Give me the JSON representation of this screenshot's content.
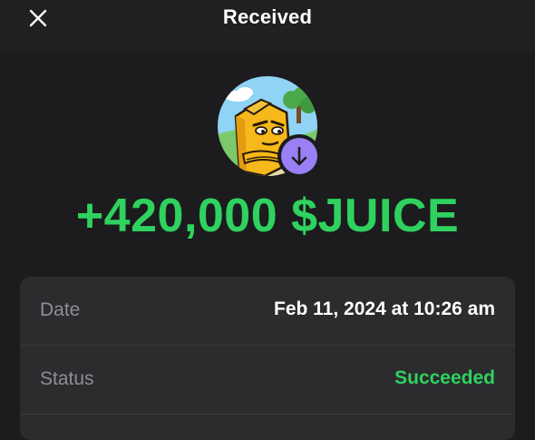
{
  "header": {
    "title": "Received",
    "close_icon": "close-icon"
  },
  "transaction": {
    "direction_icon": "arrow-down-icon",
    "amount": "+420,000 $JUICE",
    "amount_color": "#2fd25e",
    "badge_color": "#9b7ff4"
  },
  "details": {
    "rows": [
      {
        "label": "Date",
        "value": "Feb 11, 2024 at 10:26 am"
      },
      {
        "label": "Status",
        "value": "Succeeded"
      }
    ]
  }
}
